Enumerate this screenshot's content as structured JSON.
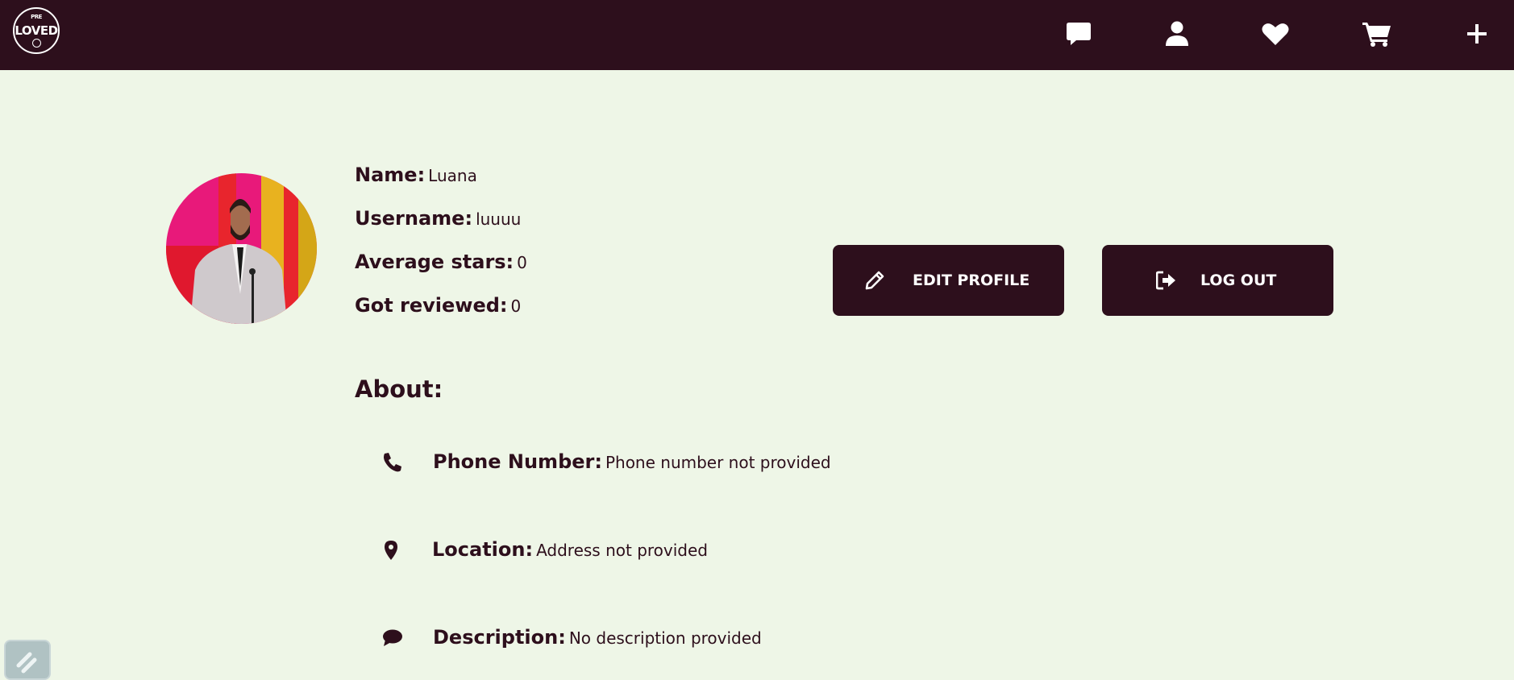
{
  "navbar": {
    "logo_top": "PRE",
    "logo_text": "LOVED",
    "icons": [
      "chat-icon",
      "user-icon",
      "heart-icon",
      "cart-icon",
      "plus-icon"
    ]
  },
  "profile": {
    "name_label": "Name:",
    "name_value": "Luana",
    "username_label": "Username:",
    "username_value": "luuuu",
    "stars_label": "Average stars:",
    "stars_value": "0",
    "reviewed_label": "Got reviewed:",
    "reviewed_value": "0"
  },
  "actions": {
    "edit_label": "EDIT PROFILE",
    "logout_label": "LOG OUT"
  },
  "about": {
    "title": "About:",
    "phone_label": "Phone Number:",
    "phone_value": "Phone number not provided",
    "location_label": "Location:",
    "location_value": "Address not provided",
    "description_label": "Description:",
    "description_value": "No description provided"
  },
  "colors": {
    "primary": "#2d0f1c",
    "background": "#eef6e7"
  }
}
